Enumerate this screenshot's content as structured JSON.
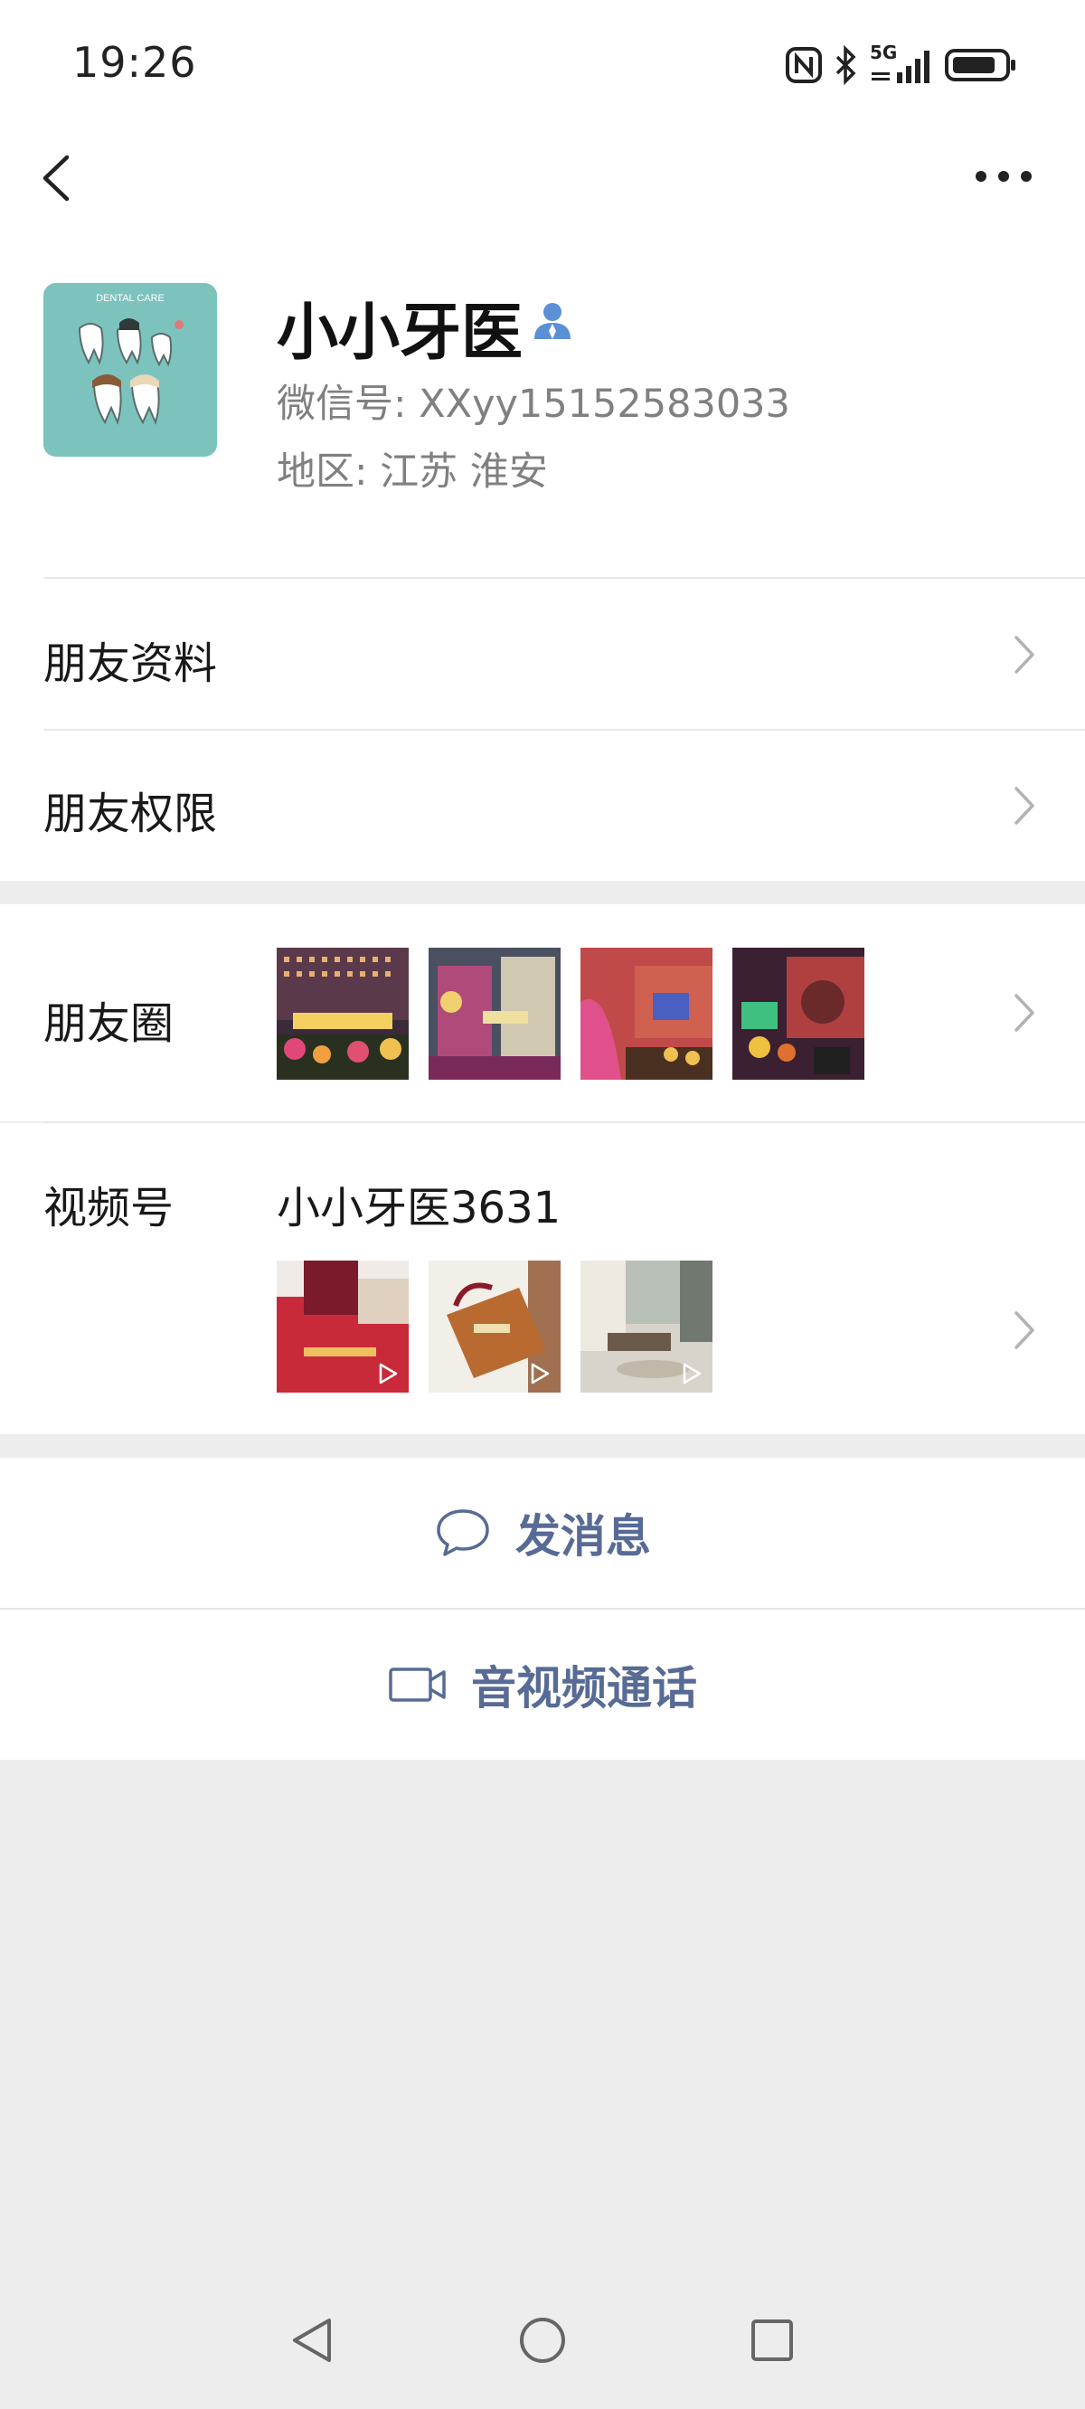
{
  "status_bar": {
    "time": "19:26",
    "network": "5G",
    "icons": [
      "nfc-icon",
      "bluetooth-icon",
      "signal-icon",
      "battery-icon"
    ]
  },
  "nav": {
    "back_icon": "chevron-left-icon",
    "more_icon": "more-dots-icon"
  },
  "profile": {
    "name": "小小牙医",
    "wechat_id": "微信号: XXyy15152583033",
    "region": "地区: 江苏  淮安",
    "avatar_text": "DENTAL CARE"
  },
  "rows": {
    "friend_info": "朋友资料",
    "friend_permission": "朋友权限",
    "moments": "朋友圈",
    "channels": "视频号",
    "channels_name": "小小牙医3631"
  },
  "actions": {
    "message": "发消息",
    "call": "音视频通话"
  },
  "colors": {
    "link": "#576b95",
    "background": "#ededed"
  }
}
